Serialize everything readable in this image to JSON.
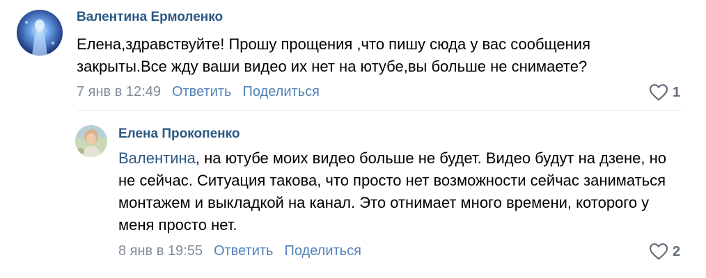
{
  "comments": [
    {
      "author": "Валентина Ермоленко",
      "text": "Елена,здравствуйте! Прошу прощения ,что пишу сюда у вас сообщения закрыты.Все жду ваши видео их нет на ютубе,вы больше не снимаете?",
      "date": "7 янв в 12:49",
      "reply_label": "Ответить",
      "share_label": "Поделиться",
      "likes": "1",
      "like_icon": "heart-outline-icon"
    },
    {
      "author": "Елена Прокопенко",
      "reply_to": "Валентина",
      "text": ", на ютубе моих видео больше не будет. Видео будут на дзене, но не сейчас. Ситуация такова, что просто нет возможности сейчас заниматься монтажем и выкладкой на канал. Это отнимает много времени, которого у меня просто нет.",
      "date": "8 янв в 19:55",
      "reply_label": "Ответить",
      "share_label": "Поделиться",
      "likes": "2",
      "like_icon": "heart-outline-icon"
    }
  ],
  "colors": {
    "author": "#2a5885",
    "action": "#5181b8",
    "meta": "#818c99",
    "like": "#626d7a",
    "divider": "#e7e8ec"
  }
}
